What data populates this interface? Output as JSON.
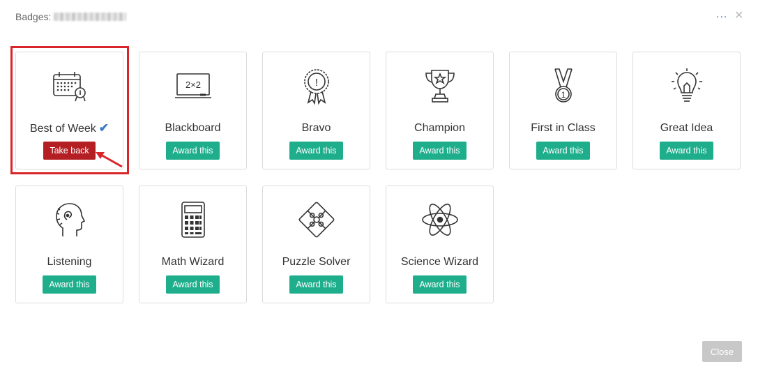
{
  "dialog": {
    "title": "Badges:",
    "more_label": "...",
    "close_x": "✕",
    "close_label": "Close"
  },
  "badges": [
    {
      "label": "Best of Week",
      "button": "Take back",
      "awarded": true,
      "icon": "calendar-icon"
    },
    {
      "label": "Blackboard",
      "button": "Award this",
      "awarded": false,
      "icon": "blackboard-icon",
      "icon_text": "2×2"
    },
    {
      "label": "Bravo",
      "button": "Award this",
      "awarded": false,
      "icon": "rosette-icon",
      "icon_text": "!"
    },
    {
      "label": "Champion",
      "button": "Award this",
      "awarded": false,
      "icon": "trophy-icon"
    },
    {
      "label": "First in Class",
      "button": "Award this",
      "awarded": false,
      "icon": "medal-icon",
      "icon_text": "1"
    },
    {
      "label": "Great Idea",
      "button": "Award this",
      "awarded": false,
      "icon": "lightbulb-icon"
    },
    {
      "label": "Listening",
      "button": "Award this",
      "awarded": false,
      "icon": "head-listening-icon"
    },
    {
      "label": "Math Wizard",
      "button": "Award this",
      "awarded": false,
      "icon": "calculator-icon"
    },
    {
      "label": "Puzzle Solver",
      "button": "Award this",
      "awarded": false,
      "icon": "puzzle-icon"
    },
    {
      "label": "Science Wizard",
      "button": "Award this",
      "awarded": false,
      "icon": "atom-icon"
    }
  ],
  "colors": {
    "award": "#1fae8c",
    "take_back": "#b41f24",
    "highlight": "#d9252a",
    "check": "#3a7bc8"
  }
}
